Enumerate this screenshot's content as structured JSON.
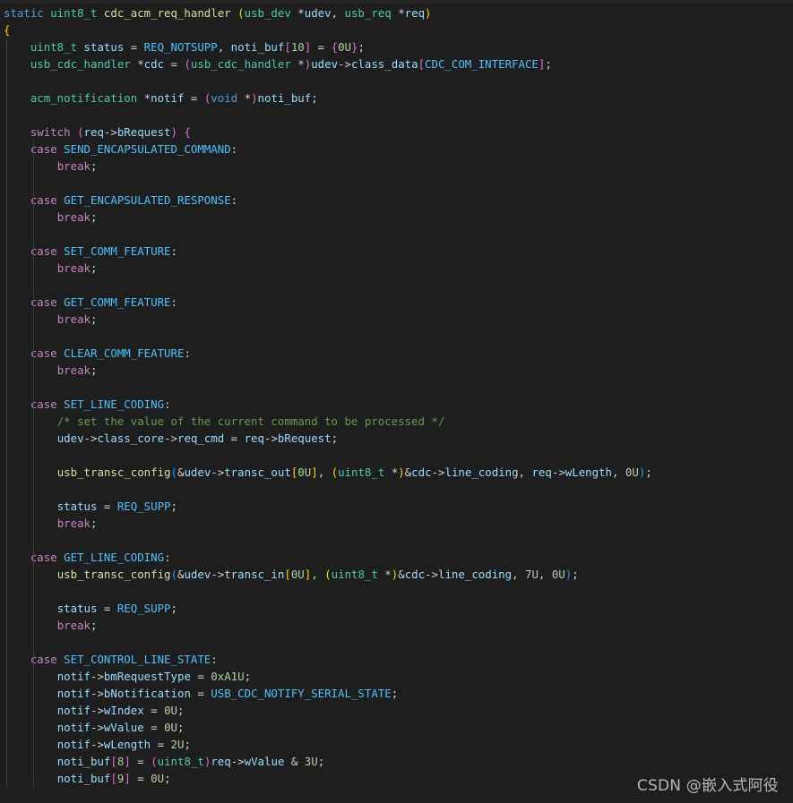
{
  "code_lines": [
    [
      {
        "t": "static ",
        "c": "kw"
      },
      {
        "t": "uint8_t ",
        "c": "ty"
      },
      {
        "t": "cdc_acm_req_handler ",
        "c": "fn"
      },
      {
        "t": "(",
        "c": "br1"
      },
      {
        "t": "usb_dev ",
        "c": "ty"
      },
      {
        "t": "*",
        "c": "pu"
      },
      {
        "t": "udev",
        "c": "va"
      },
      {
        "t": ", ",
        "c": "pu"
      },
      {
        "t": "usb_req ",
        "c": "ty"
      },
      {
        "t": "*",
        "c": "pu"
      },
      {
        "t": "req",
        "c": "va"
      },
      {
        "t": ")",
        "c": "br1"
      }
    ],
    [
      {
        "t": "{",
        "c": "br1"
      }
    ],
    [
      {
        "t": "    ",
        "c": "pu"
      },
      {
        "t": "uint8_t ",
        "c": "ty"
      },
      {
        "t": "status ",
        "c": "va"
      },
      {
        "t": "= ",
        "c": "pu"
      },
      {
        "t": "REQ_NOTSUPP",
        "c": "mc"
      },
      {
        "t": ", ",
        "c": "pu"
      },
      {
        "t": "noti_buf",
        "c": "va"
      },
      {
        "t": "[",
        "c": "br2"
      },
      {
        "t": "10",
        "c": "nu"
      },
      {
        "t": "]",
        "c": "br2"
      },
      {
        "t": " = ",
        "c": "pu"
      },
      {
        "t": "{",
        "c": "br2"
      },
      {
        "t": "0U",
        "c": "nu"
      },
      {
        "t": "}",
        "c": "br2"
      },
      {
        "t": ";",
        "c": "pu"
      }
    ],
    [
      {
        "t": "    ",
        "c": "pu"
      },
      {
        "t": "usb_cdc_handler ",
        "c": "ty"
      },
      {
        "t": "*",
        "c": "pu"
      },
      {
        "t": "cdc ",
        "c": "va"
      },
      {
        "t": "= ",
        "c": "pu"
      },
      {
        "t": "(",
        "c": "br2"
      },
      {
        "t": "usb_cdc_handler ",
        "c": "ty"
      },
      {
        "t": "*",
        "c": "pu"
      },
      {
        "t": ")",
        "c": "br2"
      },
      {
        "t": "udev",
        "c": "va"
      },
      {
        "t": "->",
        "c": "pu"
      },
      {
        "t": "class_data",
        "c": "va"
      },
      {
        "t": "[",
        "c": "br2"
      },
      {
        "t": "CDC_COM_INTERFACE",
        "c": "mc"
      },
      {
        "t": "]",
        "c": "br2"
      },
      {
        "t": ";",
        "c": "pu"
      }
    ],
    [],
    [
      {
        "t": "    ",
        "c": "pu"
      },
      {
        "t": "acm_notification ",
        "c": "ty"
      },
      {
        "t": "*",
        "c": "pu"
      },
      {
        "t": "notif ",
        "c": "va"
      },
      {
        "t": "= ",
        "c": "pu"
      },
      {
        "t": "(",
        "c": "br2"
      },
      {
        "t": "void ",
        "c": "kw"
      },
      {
        "t": "*",
        "c": "pu"
      },
      {
        "t": ")",
        "c": "br2"
      },
      {
        "t": "noti_buf",
        "c": "va"
      },
      {
        "t": ";",
        "c": "pu"
      }
    ],
    [],
    [
      {
        "t": "    ",
        "c": "pu"
      },
      {
        "t": "switch ",
        "c": "co"
      },
      {
        "t": "(",
        "c": "br2"
      },
      {
        "t": "req",
        "c": "va"
      },
      {
        "t": "->",
        "c": "pu"
      },
      {
        "t": "bRequest",
        "c": "va"
      },
      {
        "t": ")",
        "c": "br2"
      },
      {
        "t": " ",
        "c": "pu"
      },
      {
        "t": "{",
        "c": "br2"
      }
    ],
    [
      {
        "t": "    ",
        "c": "pu"
      },
      {
        "t": "case ",
        "c": "co"
      },
      {
        "t": "SEND_ENCAPSULATED_COMMAND",
        "c": "mc"
      },
      {
        "t": ":",
        "c": "pu"
      }
    ],
    [
      {
        "t": "        ",
        "c": "pu"
      },
      {
        "t": "break",
        "c": "co"
      },
      {
        "t": ";",
        "c": "pu"
      }
    ],
    [],
    [
      {
        "t": "    ",
        "c": "pu"
      },
      {
        "t": "case ",
        "c": "co"
      },
      {
        "t": "GET_ENCAPSULATED_RESPONSE",
        "c": "mc"
      },
      {
        "t": ":",
        "c": "pu"
      }
    ],
    [
      {
        "t": "        ",
        "c": "pu"
      },
      {
        "t": "break",
        "c": "co"
      },
      {
        "t": ";",
        "c": "pu"
      }
    ],
    [],
    [
      {
        "t": "    ",
        "c": "pu"
      },
      {
        "t": "case ",
        "c": "co"
      },
      {
        "t": "SET_COMM_FEATURE",
        "c": "mc"
      },
      {
        "t": ":",
        "c": "pu"
      }
    ],
    [
      {
        "t": "        ",
        "c": "pu"
      },
      {
        "t": "break",
        "c": "co"
      },
      {
        "t": ";",
        "c": "pu"
      }
    ],
    [],
    [
      {
        "t": "    ",
        "c": "pu"
      },
      {
        "t": "case ",
        "c": "co"
      },
      {
        "t": "GET_COMM_FEATURE",
        "c": "mc"
      },
      {
        "t": ":",
        "c": "pu"
      }
    ],
    [
      {
        "t": "        ",
        "c": "pu"
      },
      {
        "t": "break",
        "c": "co"
      },
      {
        "t": ";",
        "c": "pu"
      }
    ],
    [],
    [
      {
        "t": "    ",
        "c": "pu"
      },
      {
        "t": "case ",
        "c": "co"
      },
      {
        "t": "CLEAR_COMM_FEATURE",
        "c": "mc"
      },
      {
        "t": ":",
        "c": "pu"
      }
    ],
    [
      {
        "t": "        ",
        "c": "pu"
      },
      {
        "t": "break",
        "c": "co"
      },
      {
        "t": ";",
        "c": "pu"
      }
    ],
    [],
    [
      {
        "t": "    ",
        "c": "pu"
      },
      {
        "t": "case ",
        "c": "co"
      },
      {
        "t": "SET_LINE_CODING",
        "c": "mc"
      },
      {
        "t": ":",
        "c": "pu"
      }
    ],
    [
      {
        "t": "        ",
        "c": "pu"
      },
      {
        "t": "/* set the value of the current command to be processed */",
        "c": "cm"
      }
    ],
    [
      {
        "t": "        ",
        "c": "pu"
      },
      {
        "t": "udev",
        "c": "va"
      },
      {
        "t": "->",
        "c": "pu"
      },
      {
        "t": "class_core",
        "c": "va"
      },
      {
        "t": "->",
        "c": "pu"
      },
      {
        "t": "req_cmd ",
        "c": "va"
      },
      {
        "t": "= ",
        "c": "pu"
      },
      {
        "t": "req",
        "c": "va"
      },
      {
        "t": "->",
        "c": "pu"
      },
      {
        "t": "bRequest",
        "c": "va"
      },
      {
        "t": ";",
        "c": "pu"
      }
    ],
    [],
    [
      {
        "t": "        ",
        "c": "pu"
      },
      {
        "t": "usb_transc_config",
        "c": "fn"
      },
      {
        "t": "(",
        "c": "br3"
      },
      {
        "t": "&",
        "c": "pu"
      },
      {
        "t": "udev",
        "c": "va"
      },
      {
        "t": "->",
        "c": "pu"
      },
      {
        "t": "transc_out",
        "c": "va"
      },
      {
        "t": "[",
        "c": "br1"
      },
      {
        "t": "0U",
        "c": "nu"
      },
      {
        "t": "]",
        "c": "br1"
      },
      {
        "t": ", ",
        "c": "pu"
      },
      {
        "t": "(",
        "c": "br1"
      },
      {
        "t": "uint8_t ",
        "c": "ty"
      },
      {
        "t": "*",
        "c": "pu"
      },
      {
        "t": ")",
        "c": "br1"
      },
      {
        "t": "&",
        "c": "pu"
      },
      {
        "t": "cdc",
        "c": "va"
      },
      {
        "t": "->",
        "c": "pu"
      },
      {
        "t": "line_coding",
        "c": "va"
      },
      {
        "t": ", ",
        "c": "pu"
      },
      {
        "t": "req",
        "c": "va"
      },
      {
        "t": "->",
        "c": "pu"
      },
      {
        "t": "wLength",
        "c": "va"
      },
      {
        "t": ", ",
        "c": "pu"
      },
      {
        "t": "0U",
        "c": "nu"
      },
      {
        "t": ")",
        "c": "br3"
      },
      {
        "t": ";",
        "c": "pu"
      }
    ],
    [],
    [
      {
        "t": "        ",
        "c": "pu"
      },
      {
        "t": "status ",
        "c": "va"
      },
      {
        "t": "= ",
        "c": "pu"
      },
      {
        "t": "REQ_SUPP",
        "c": "mc"
      },
      {
        "t": ";",
        "c": "pu"
      }
    ],
    [
      {
        "t": "        ",
        "c": "pu"
      },
      {
        "t": "break",
        "c": "co"
      },
      {
        "t": ";",
        "c": "pu"
      }
    ],
    [],
    [
      {
        "t": "    ",
        "c": "pu"
      },
      {
        "t": "case ",
        "c": "co"
      },
      {
        "t": "GET_LINE_CODING",
        "c": "mc"
      },
      {
        "t": ":",
        "c": "pu"
      }
    ],
    [
      {
        "t": "        ",
        "c": "pu"
      },
      {
        "t": "usb_transc_config",
        "c": "fn"
      },
      {
        "t": "(",
        "c": "br3"
      },
      {
        "t": "&",
        "c": "pu"
      },
      {
        "t": "udev",
        "c": "va"
      },
      {
        "t": "->",
        "c": "pu"
      },
      {
        "t": "transc_in",
        "c": "va"
      },
      {
        "t": "[",
        "c": "br1"
      },
      {
        "t": "0U",
        "c": "nu"
      },
      {
        "t": "]",
        "c": "br1"
      },
      {
        "t": ", ",
        "c": "pu"
      },
      {
        "t": "(",
        "c": "br1"
      },
      {
        "t": "uint8_t ",
        "c": "ty"
      },
      {
        "t": "*",
        "c": "pu"
      },
      {
        "t": ")",
        "c": "br1"
      },
      {
        "t": "&",
        "c": "pu"
      },
      {
        "t": "cdc",
        "c": "va"
      },
      {
        "t": "->",
        "c": "pu"
      },
      {
        "t": "line_coding",
        "c": "va"
      },
      {
        "t": ", ",
        "c": "pu"
      },
      {
        "t": "7U",
        "c": "nu"
      },
      {
        "t": ", ",
        "c": "pu"
      },
      {
        "t": "0U",
        "c": "nu"
      },
      {
        "t": ")",
        "c": "br3"
      },
      {
        "t": ";",
        "c": "pu"
      }
    ],
    [],
    [
      {
        "t": "        ",
        "c": "pu"
      },
      {
        "t": "status ",
        "c": "va"
      },
      {
        "t": "= ",
        "c": "pu"
      },
      {
        "t": "REQ_SUPP",
        "c": "mc"
      },
      {
        "t": ";",
        "c": "pu"
      }
    ],
    [
      {
        "t": "        ",
        "c": "pu"
      },
      {
        "t": "break",
        "c": "co"
      },
      {
        "t": ";",
        "c": "pu"
      }
    ],
    [],
    [
      {
        "t": "    ",
        "c": "pu"
      },
      {
        "t": "case ",
        "c": "co"
      },
      {
        "t": "SET_CONTROL_LINE_STATE",
        "c": "mc"
      },
      {
        "t": ":",
        "c": "pu"
      }
    ],
    [
      {
        "t": "        ",
        "c": "pu"
      },
      {
        "t": "notif",
        "c": "va"
      },
      {
        "t": "->",
        "c": "pu"
      },
      {
        "t": "bmRequestType ",
        "c": "va"
      },
      {
        "t": "= ",
        "c": "pu"
      },
      {
        "t": "0xA1U",
        "c": "nu"
      },
      {
        "t": ";",
        "c": "pu"
      }
    ],
    [
      {
        "t": "        ",
        "c": "pu"
      },
      {
        "t": "notif",
        "c": "va"
      },
      {
        "t": "->",
        "c": "pu"
      },
      {
        "t": "bNotification ",
        "c": "va"
      },
      {
        "t": "= ",
        "c": "pu"
      },
      {
        "t": "USB_CDC_NOTIFY_SERIAL_STATE",
        "c": "mc"
      },
      {
        "t": ";",
        "c": "pu"
      }
    ],
    [
      {
        "t": "        ",
        "c": "pu"
      },
      {
        "t": "notif",
        "c": "va"
      },
      {
        "t": "->",
        "c": "pu"
      },
      {
        "t": "wIndex ",
        "c": "va"
      },
      {
        "t": "= ",
        "c": "pu"
      },
      {
        "t": "0U",
        "c": "nu"
      },
      {
        "t": ";",
        "c": "pu"
      }
    ],
    [
      {
        "t": "        ",
        "c": "pu"
      },
      {
        "t": "notif",
        "c": "va"
      },
      {
        "t": "->",
        "c": "pu"
      },
      {
        "t": "wValue ",
        "c": "va"
      },
      {
        "t": "= ",
        "c": "pu"
      },
      {
        "t": "0U",
        "c": "nu"
      },
      {
        "t": ";",
        "c": "pu"
      }
    ],
    [
      {
        "t": "        ",
        "c": "pu"
      },
      {
        "t": "notif",
        "c": "va"
      },
      {
        "t": "->",
        "c": "pu"
      },
      {
        "t": "wLength ",
        "c": "va"
      },
      {
        "t": "= ",
        "c": "pu"
      },
      {
        "t": "2U",
        "c": "nu"
      },
      {
        "t": ";",
        "c": "pu"
      }
    ],
    [
      {
        "t": "        ",
        "c": "pu"
      },
      {
        "t": "noti_buf",
        "c": "va"
      },
      {
        "t": "[",
        "c": "br2"
      },
      {
        "t": "8",
        "c": "nu"
      },
      {
        "t": "]",
        "c": "br2"
      },
      {
        "t": " = ",
        "c": "pu"
      },
      {
        "t": "(",
        "c": "br2"
      },
      {
        "t": "uint8_t",
        "c": "ty"
      },
      {
        "t": ")",
        "c": "br2"
      },
      {
        "t": "req",
        "c": "va"
      },
      {
        "t": "->",
        "c": "pu"
      },
      {
        "t": "wValue ",
        "c": "va"
      },
      {
        "t": "& ",
        "c": "pu"
      },
      {
        "t": "3U",
        "c": "nu"
      },
      {
        "t": ";",
        "c": "pu"
      }
    ],
    [
      {
        "t": "        ",
        "c": "pu"
      },
      {
        "t": "noti_buf",
        "c": "va"
      },
      {
        "t": "[",
        "c": "br2"
      },
      {
        "t": "9",
        "c": "nu"
      },
      {
        "t": "]",
        "c": "br2"
      },
      {
        "t": " = ",
        "c": "pu"
      },
      {
        "t": "0U",
        "c": "nu"
      },
      {
        "t": ";",
        "c": "pu"
      }
    ]
  ],
  "watermark": "CSDN @嵌入式阿役"
}
